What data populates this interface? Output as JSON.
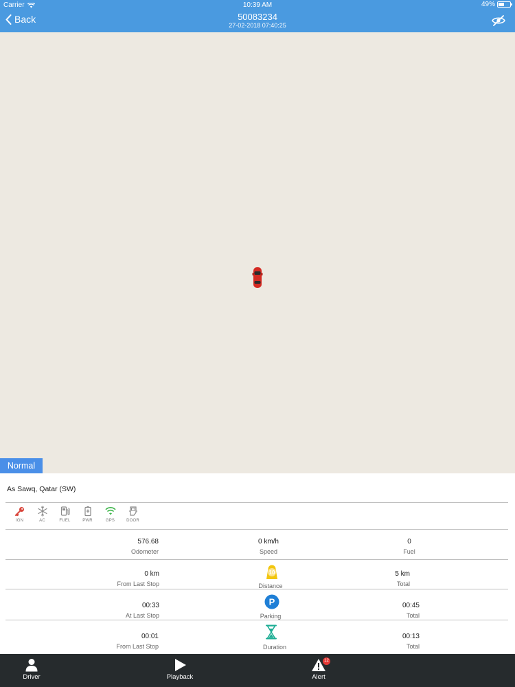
{
  "status_bar": {
    "carrier": "Carrier",
    "time": "10:39 AM",
    "battery": "49%",
    "battery_level": 0.49
  },
  "header": {
    "back_label": "Back",
    "title": "50083234",
    "subtitle": "27-02-2018 07:40:25",
    "visibility_icon": "eye-slash-icon"
  },
  "map": {
    "marker_icon": "red-car-icon"
  },
  "status_tab": "Normal",
  "info": {
    "address": "As Sawq, Qatar (SW)",
    "sensors": [
      {
        "label": "IGN",
        "icon": "key-icon",
        "color": "#d9453b"
      },
      {
        "label": "AC",
        "icon": "snowflake-icon",
        "color": "#8a8a8a"
      },
      {
        "label": "FUEL",
        "icon": "fuel-pump-icon",
        "color": "#8a8a8a"
      },
      {
        "label": "PWR",
        "icon": "battery-icon",
        "color": "#8a8a8a"
      },
      {
        "label": "GPS",
        "icon": "wifi-signal-icon",
        "color": "#3db54a"
      },
      {
        "label": "DOOR",
        "icon": "car-door-icon",
        "color": "#8a8a8a"
      }
    ],
    "rows": [
      {
        "left_value": "576.68",
        "left_label": "Odometer",
        "mid_value": "0 km/h",
        "mid_label": "Speed",
        "right_value": "0",
        "right_label": "Fuel"
      },
      {
        "left_value": "0 km",
        "left_label": "From Last Stop",
        "mid_icon": "distance-10-icon",
        "mid_badge": "10",
        "mid_label": "Distance",
        "right_value": "5 km",
        "right_label": "Total"
      },
      {
        "left_value": "00:33",
        "left_label": "At Last Stop",
        "mid_icon": "parking-icon",
        "mid_badge": "P",
        "mid_label": "Parking",
        "right_value": "00:45",
        "right_label": "Total"
      },
      {
        "left_value": "00:01",
        "left_label": "From Last Stop",
        "mid_icon": "hourglass-icon",
        "mid_label": "Duration",
        "right_value": "00:13",
        "right_label": "Total"
      }
    ]
  },
  "tabbar": {
    "driver_label": "Driver",
    "playback_label": "Playback",
    "alert_label": "Alert",
    "alert_badge": "12"
  },
  "colors": {
    "header": "#4a9ae0",
    "accent": "#4a8fe8",
    "map": "#ede9e1",
    "tabbar": "#262b2d"
  }
}
